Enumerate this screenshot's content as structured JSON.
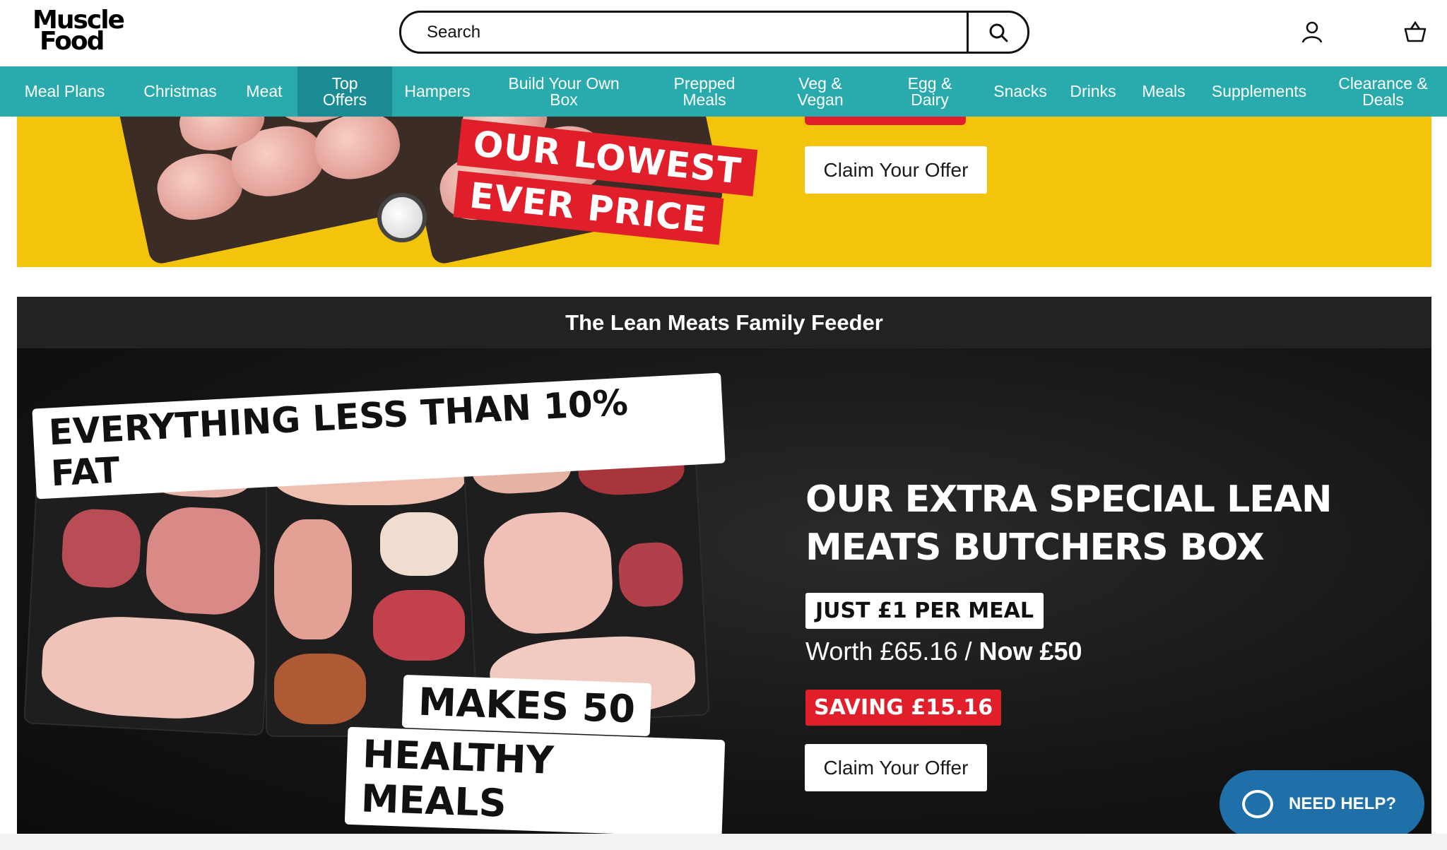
{
  "header": {
    "logo_line1": "Muscle",
    "logo_line2": "Food",
    "search_placeholder": "Search",
    "icons": [
      "search-icon",
      "user-icon",
      "basket-icon"
    ]
  },
  "nav": [
    {
      "label": "Meal Plans"
    },
    {
      "label": "Christmas"
    },
    {
      "label": "Meat"
    },
    {
      "label": "Top Offers",
      "active": true
    },
    {
      "label": "Hampers"
    },
    {
      "label": "Build Your Own Box"
    },
    {
      "label": "Prepped Meals"
    },
    {
      "label": "Veg & Vegan"
    },
    {
      "label": "Egg & Dairy"
    },
    {
      "label": "Snacks"
    },
    {
      "label": "Drinks"
    },
    {
      "label": "Meals"
    },
    {
      "label": "Supplements"
    },
    {
      "label": "Clearance & Deals"
    }
  ],
  "promo1": {
    "tag_line1": "OUR LOWEST",
    "tag_line2": "EVER PRICE",
    "cta": "Claim Your Offer"
  },
  "promo2": {
    "title": "The Lean Meats Family Feeder",
    "image_tag_top": "EVERYTHING LESS THAN 10% FAT",
    "image_tag_bottom1": "MAKES 50",
    "image_tag_bottom2": "HEALTHY MEALS",
    "headline_line1": "OUR EXTRA SPECIAL LEAN",
    "headline_line2": "MEATS BUTCHERS BOX",
    "meal_tag": "JUST £1 PER MEAL",
    "worth": "Worth £65.16",
    "separator": " / ",
    "now": "Now £50",
    "saving": "SAVING £15.16",
    "cta": "Claim Your Offer"
  },
  "help_button": "NEED HELP?",
  "colors": {
    "nav_bg": "#29abad",
    "nav_active": "#1b8b94",
    "promo_yellow": "#f3c40b",
    "accent_red": "#e01f2a",
    "help_blue": "#1f6fa8"
  }
}
